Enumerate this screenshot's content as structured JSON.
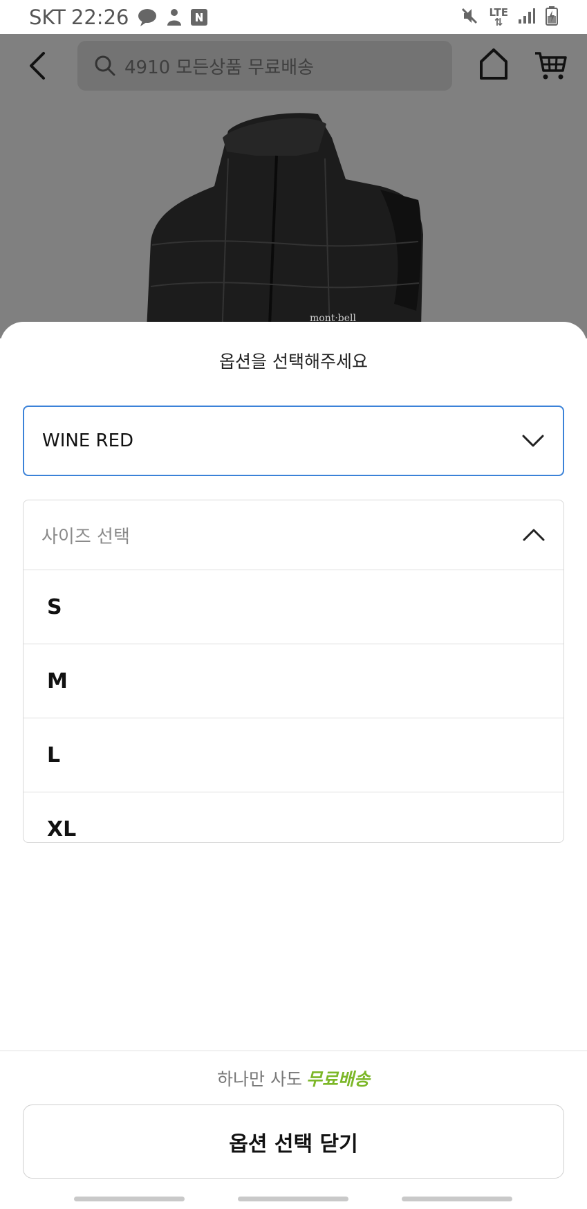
{
  "status_bar": {
    "carrier": "SKT",
    "time": "22:26",
    "network": "LTE",
    "icons": [
      "chat-bubble-icon",
      "person-icon",
      "naver-n-icon",
      "mute-icon",
      "lte-icon",
      "signal-icon",
      "battery-charging-icon"
    ]
  },
  "header": {
    "search_placeholder": "4910 모든상품 무료배송",
    "icons": [
      "back-arrow-icon",
      "search-icon",
      "home-icon",
      "cart-icon"
    ]
  },
  "product": {
    "brand_logo_text": "mont·bell"
  },
  "option_sheet": {
    "title": "옵션을 선택해주세요",
    "color_select": {
      "selected_value": "WINE RED"
    },
    "size_select": {
      "placeholder": "사이즈 선택",
      "expanded": true,
      "options": [
        "S",
        "M",
        "L",
        "XL"
      ]
    },
    "promo": {
      "prefix": "하나만 사도",
      "highlight": "무료배송",
      "highlight_color": "#7cb728"
    },
    "close_button_label": "옵션 선택 닫기"
  },
  "colors": {
    "accent_border": "#3b82d8",
    "overlay_dim": "#808080"
  }
}
